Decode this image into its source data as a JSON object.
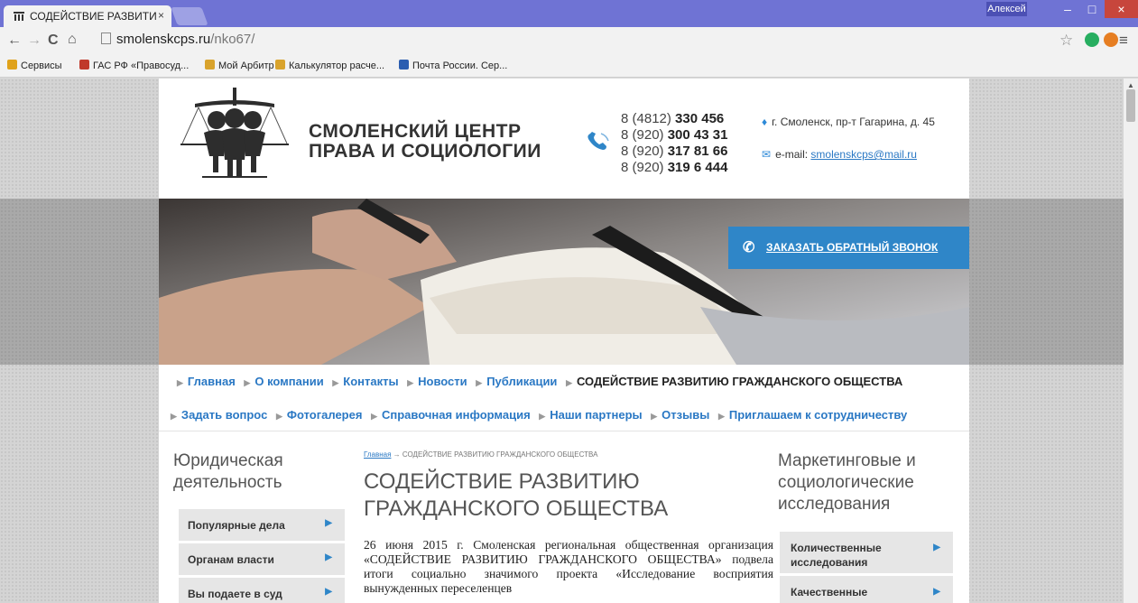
{
  "browser": {
    "tab_title": "СОДЕЙСТВИЕ РАЗВИТИ",
    "tab_close": "×",
    "user_name": "Алексей",
    "url_host": "smolenskcps.ru",
    "url_path": "/nko67/",
    "bookmarks": [
      {
        "label": "Сервисы",
        "icon": "apps-icon",
        "color": "#e0a21a"
      },
      {
        "label": "ГАС РФ «Правосуд...",
        "icon": "gas-icon",
        "color": "#c0392b"
      },
      {
        "label": "Мой Арбитр",
        "icon": "arbitr-icon",
        "color": "#d9a32c"
      },
      {
        "label": "Калькулятор расче...",
        "icon": "calc-icon",
        "color": "#d9a32c"
      },
      {
        "label": "Почта России. Сер...",
        "icon": "post-icon",
        "color": "#2a5db0"
      }
    ]
  },
  "header": {
    "brand_line1": "СМОЛЕНСКИЙ ЦЕНТР",
    "brand_line2": "ПРАВА И СОЦИОЛОГИИ",
    "phones": [
      {
        "prefix": "8 (4812) ",
        "number": "330 456"
      },
      {
        "prefix": "8 (920) ",
        "number": "300 43 31"
      },
      {
        "prefix": "8 (920) ",
        "number": "317 81 66"
      },
      {
        "prefix": "8 (920) ",
        "number": "319 6 444"
      }
    ],
    "address": "г. Смоленск, пр-т Гагарина, д. 45",
    "email_label": "e-mail:",
    "email": "smolenskcps@mail.ru",
    "accent_color": "#2f86c8"
  },
  "hero": {
    "callback_label": "ЗАКАЗАТЬ ОБРАТНЫЙ ЗВОНОК"
  },
  "menu": {
    "row1": [
      "Главная",
      "О компании",
      "Контакты",
      "Новости",
      "Публикации",
      "СОДЕЙСТВИЕ РАЗВИТИЮ ГРАЖДАНСКОГО ОБЩЕСТВА"
    ],
    "row2": [
      "Задать вопрос",
      "Фотогалерея",
      "Справочная информация",
      "Наши партнеры",
      "Отзывы",
      "Приглашаем к сотрудничеству"
    ]
  },
  "left_sidebar": {
    "heading_line1": "Юридическая",
    "heading_line2": "деятельность",
    "items": [
      "Популярные дела",
      "Органам власти",
      "Вы подаете в суд"
    ]
  },
  "content": {
    "breadcrumb_home": "Главная",
    "breadcrumb_sep": " → ",
    "breadcrumb_current": "СОДЕЙСТВИЕ РАЗВИТИЮ ГРАЖДАНСКОГО ОБЩЕСТВА",
    "title": "СОДЕЙСТВИЕ РАЗВИТИЮ ГРАЖДАНСКОГО ОБЩЕСТВА",
    "text": "26 июня 2015 г. Смоленская региональная общественная организация «СОДЕЙСТВИЕ РАЗВИТИЮ ГРАЖДАНСКОГО ОБЩЕСТВА» подвела итоги социально значимого проекта «Исследование восприятия вынужденных переселенцев"
  },
  "right_sidebar": {
    "heading_line1": "Маркетинговые и",
    "heading_line2": "социологические",
    "heading_line3": "исследования",
    "items": [
      "Количественные исследования",
      "Качественные"
    ]
  }
}
